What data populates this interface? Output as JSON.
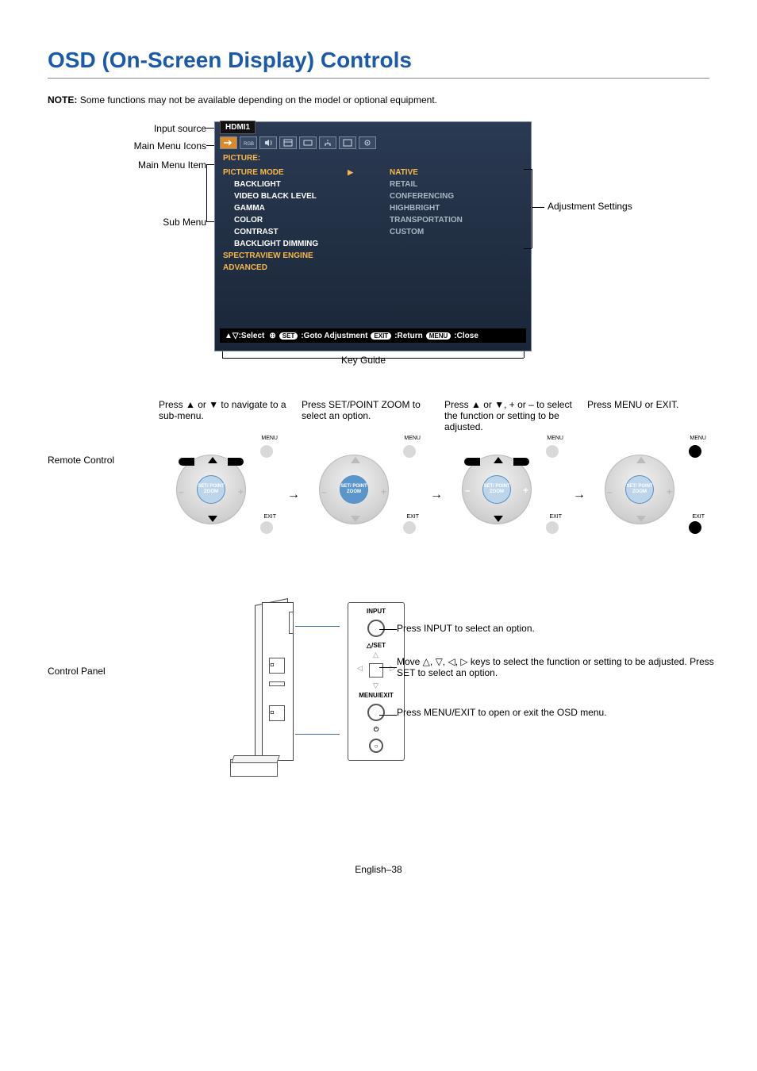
{
  "title": "OSD (On-Screen Display) Controls",
  "note_label": "NOTE:",
  "note_text": "Some functions may not be available depending on the model or optional equipment.",
  "annot": {
    "input_source": "Input source",
    "main_menu_icons": "Main Menu Icons",
    "main_menu_item": "Main Menu Item",
    "sub_menu": "Sub Menu",
    "adjustment": "Adjustment Settings",
    "key_guide": "Key Guide"
  },
  "osd": {
    "input_badge": "HDMI1",
    "section": "PICTURE:",
    "menu": {
      "selected": "PICTURE MODE",
      "sub": [
        "BACKLIGHT",
        "VIDEO BLACK LEVEL",
        "GAMMA",
        "COLOR",
        "CONTRAST",
        "BACKLIGHT DIMMING"
      ],
      "top_after": [
        "SPECTRAVIEW ENGINE",
        "ADVANCED"
      ]
    },
    "adjust": {
      "selected": "NATIVE",
      "items": [
        "RETAIL",
        "CONFERENCING",
        "HIGHBRIGHT",
        "TRANSPORTATION",
        "CUSTOM"
      ]
    },
    "key_guide_text": ":Select    :Goto Adjustment    :Return    :Close",
    "kg_pills": {
      "set": "SET",
      "exit": "EXIT",
      "menu": "MENU"
    }
  },
  "remote": {
    "label": "Remote Control",
    "step1": "Press ▲ or ▼ to navigate to a sub-menu.",
    "step2": "Press SET/POINT ZOOM to select an option.",
    "step3": "Press ▲ or ▼, + or – to select the function or setting to be adjusted.",
    "step4": "Press MENU or EXIT.",
    "center": "SET/\nPOINT ZOOM",
    "menu_lbl": "MENU",
    "exit_lbl": "EXIT"
  },
  "control_panel": {
    "label": "Control Panel",
    "input_lbl": "INPUT",
    "set_lbl": "△/SET",
    "menu_lbl": "MENU/EXIT",
    "pwr_lbl": "⏻",
    "info1": "Press INPUT to select an option.",
    "info2": "Move △, ▽, ◁, ▷ keys to select the function or setting to be adjusted. Press SET to select an option.",
    "info3": "Press MENU/EXIT to open or exit the OSD menu."
  },
  "footer": "English–38"
}
